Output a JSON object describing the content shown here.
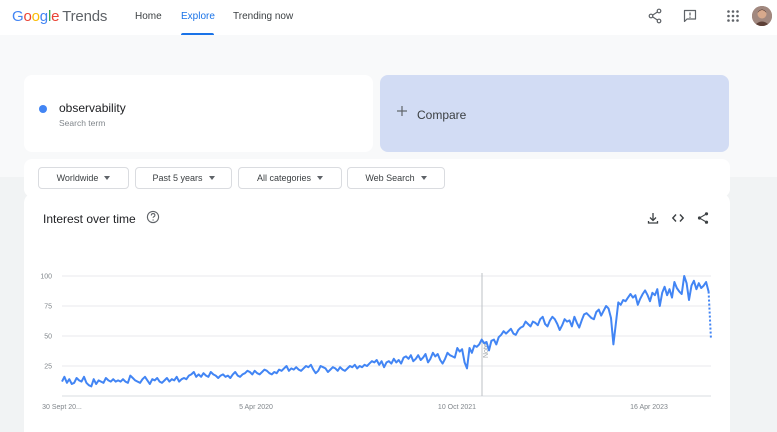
{
  "header": {
    "logo": {
      "google": [
        "G",
        "o",
        "o",
        "g",
        "l",
        "e"
      ],
      "trends": "Trends"
    },
    "nav": [
      {
        "label": "Home",
        "active": false
      },
      {
        "label": "Explore",
        "active": true
      },
      {
        "label": "Trending now",
        "active": false
      }
    ],
    "icons": [
      "share-icon",
      "feedback-icon",
      "apps-grid-icon",
      "avatar"
    ]
  },
  "search": {
    "term": {
      "name": "observability",
      "sub": "Search term",
      "color": "#4285f4"
    },
    "compare": {
      "label": "Compare",
      "icon": "plus-icon"
    }
  },
  "filters": [
    {
      "label": "Worldwide"
    },
    {
      "label": "Past 5 years"
    },
    {
      "label": "All categories"
    },
    {
      "label": "Web Search"
    }
  ],
  "interest": {
    "title": "Interest over time",
    "icons": [
      "help-icon",
      "download-icon",
      "embed-icon",
      "share-icon"
    ]
  },
  "chart_data": {
    "type": "line",
    "ylim": [
      0,
      100
    ],
    "yticks": [
      25,
      50,
      75,
      100
    ],
    "xtick_labels": [
      "30 Sept 20...",
      "5 Apr 2020",
      "10 Oct 2021",
      "16 Apr 2023"
    ],
    "note_label": "Note",
    "grid": true,
    "series": [
      {
        "color": "#4285f4",
        "values": [
          12,
          16,
          11,
          14,
          10,
          11,
          15,
          13,
          12,
          16,
          11,
          9,
          8,
          14,
          10,
          13,
          12,
          11,
          15,
          13,
          12,
          14,
          12,
          13,
          12,
          14,
          12,
          11,
          17,
          15,
          13,
          12,
          11,
          14,
          16,
          13,
          10,
          14,
          13,
          15,
          12,
          11,
          13,
          15,
          12,
          14,
          13,
          16,
          12,
          14,
          15,
          14,
          17,
          18,
          20,
          16,
          18,
          16,
          19,
          17,
          16,
          20,
          18,
          17,
          15,
          17,
          18,
          16,
          17,
          15,
          18,
          20,
          17,
          16,
          18,
          19,
          21,
          20,
          18,
          21,
          19,
          18,
          20,
          22,
          21,
          19,
          18,
          20,
          19,
          22,
          21,
          23,
          25,
          21,
          23,
          22,
          24,
          22,
          21,
          23,
          25,
          24,
          26,
          22,
          19,
          21,
          25,
          24,
          23,
          20,
          22,
          24,
          23,
          21,
          24,
          22,
          21,
          23,
          25,
          24,
          26,
          23,
          25,
          24,
          26,
          25,
          27,
          29,
          28,
          30,
          26,
          29,
          24,
          28,
          29,
          27,
          31,
          28,
          30,
          27,
          32,
          33,
          31,
          34,
          29,
          31,
          34,
          30,
          32,
          35,
          28,
          31,
          36,
          33,
          35,
          30,
          27,
          31,
          36,
          34,
          33,
          32,
          40,
          37,
          39,
          28,
          23,
          40,
          36,
          42,
          41,
          43,
          47,
          44,
          45,
          38,
          46,
          47,
          43,
          49,
          51,
          54,
          52,
          54,
          56,
          52,
          51,
          55,
          57,
          58,
          62,
          60,
          58,
          62,
          61,
          59,
          64,
          66,
          60,
          58,
          63,
          66,
          64,
          60,
          55,
          59,
          64,
          62,
          63,
          58,
          66,
          61,
          57,
          63,
          68,
          69,
          67,
          65,
          64,
          70,
          72,
          67,
          71,
          75,
          73,
          65,
          43,
          60,
          78,
          76,
          80,
          79,
          82,
          85,
          82,
          84,
          76,
          81,
          85,
          88,
          84,
          79,
          86,
          84,
          89,
          75,
          86,
          91,
          84,
          89,
          82,
          95,
          90,
          87,
          85,
          100,
          94,
          80,
          92,
          96,
          89,
          94,
          90,
          92,
          95,
          87,
          47
        ]
      }
    ]
  }
}
